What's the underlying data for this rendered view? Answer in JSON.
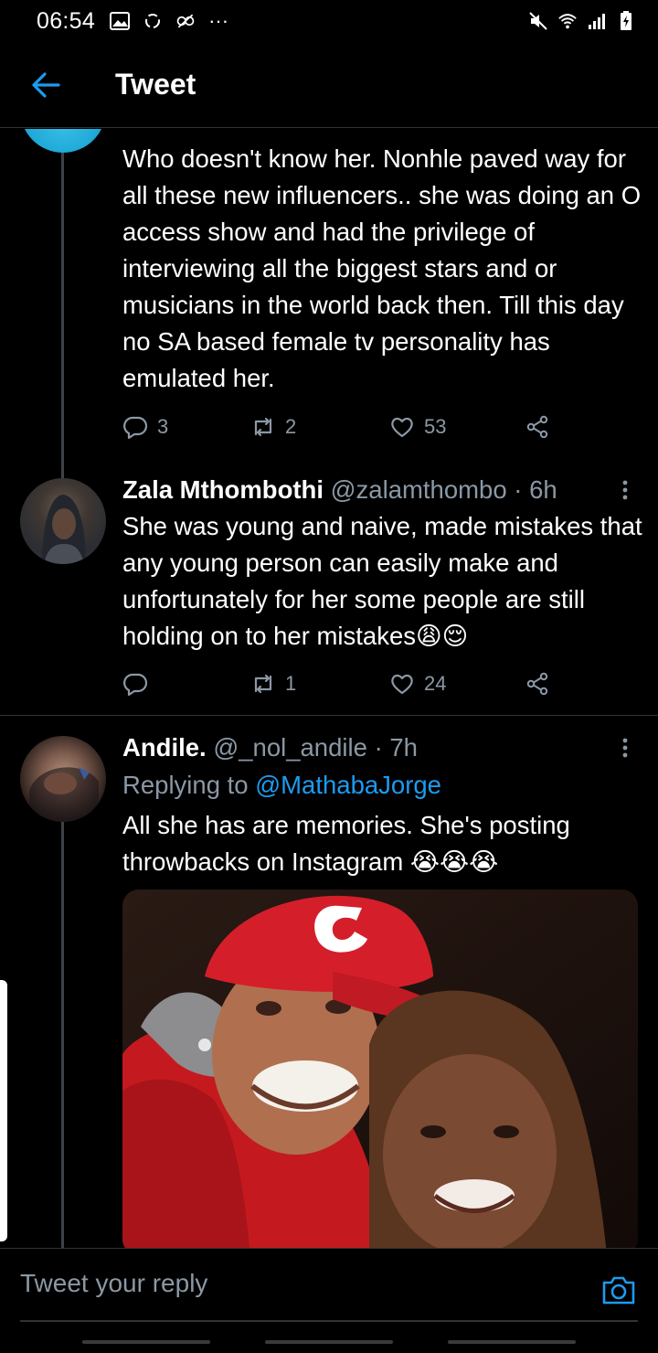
{
  "status_bar": {
    "time": "06:54",
    "overflow": "···"
  },
  "header": {
    "title": "Tweet"
  },
  "tweets": [
    {
      "text": "Who doesn't know her. Nonhle paved way for all these new influencers.. she was doing an O access show and had the privilege of interviewing all the biggest stars and or musicians in the world back then. Till this day no SA based female tv personality has emulated her.",
      "replies": "3",
      "retweets": "2",
      "likes": "53"
    },
    {
      "name": "Zala Mthombothi",
      "handle": "@zalamthombo",
      "time": "· 6h",
      "text": "She was young and naive, made mistakes that any young person can easily make and unfortunately for her some people are still holding on to her mistakes😩😌",
      "replies": "",
      "retweets": "1",
      "likes": "24"
    },
    {
      "name": "Andile.",
      "handle": "@_nol_andile",
      "time": "· 7h",
      "replying_prefix": "Replying to ",
      "replying_to": "@MathabaJorge",
      "text": "All she has are memories. She's posting throwbacks on Instagram 😭😭😭"
    }
  ],
  "reply_bar": {
    "placeholder": "Tweet your reply"
  },
  "colors": {
    "background": "#000000",
    "accent": "#1d9bf0",
    "secondary_text": "#8b98a5",
    "divider": "#2f3336"
  },
  "icons": [
    "back-arrow-icon",
    "reply-icon",
    "retweet-icon",
    "like-icon",
    "share-icon",
    "more-icon",
    "camera-icon"
  ]
}
